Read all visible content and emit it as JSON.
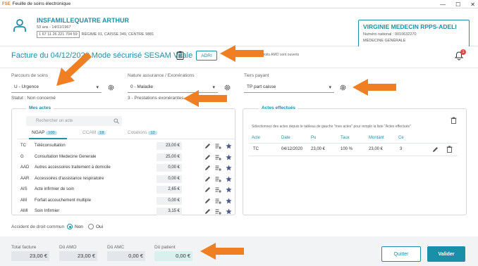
{
  "window": {
    "logo": "FSE",
    "title": "Feuille de soins électronique",
    "minimize_glyph": "—",
    "maximize_glyph": "☐",
    "close_glyph": "✕"
  },
  "patient": {
    "name": "INSFAMILLEQUATRE ARTHUR",
    "birth_info": "53 ans - 14/11/1967",
    "nir": "1 67 11 26 221 704 59",
    "regime": "RÉGIME 01, CAISSE 349, CENTRE 9881"
  },
  "doctor": {
    "name": "VIRGINIE MEDECIN RPPS-ADELI",
    "national_number": "Numéro national : 0010632270",
    "specialty": "MÉDECINE GÉNÉRALE"
  },
  "invoice": {
    "title": "Facture du 04/12/2020 Mode sécurisé SESAM Vitale",
    "adri_label": "ADRI",
    "amo_note": "Droits AMO sont ouverts",
    "notification_count": "1"
  },
  "fields": {
    "parcours_label": "Parcours de soins",
    "parcours_value": "U - Urgence",
    "statut_note": "Statut : Non concerné",
    "nature_label": "Nature assurance / Exonérations",
    "nature_value": "0 - Maladie",
    "exoneration_note": "3 - Prestations exonérantes",
    "tiers_label": "Tiers payant",
    "tiers_value": "TP part caisse"
  },
  "mes_actes": {
    "legend": "Mes actes",
    "search_placeholder": "Rechercher un acte",
    "tabs": [
      {
        "label": "NGAP",
        "count": "100"
      },
      {
        "label": "CCAM",
        "count": "18"
      },
      {
        "label": "Cotations",
        "count": "12"
      }
    ],
    "rows": [
      {
        "code": "TC",
        "label": "Téléconsultation",
        "price": "23,00 €"
      },
      {
        "code": "G",
        "label": "Consultation Medecine Generale",
        "price": "25,00 €"
      },
      {
        "code": "AAD",
        "label": "Autres accessoires traitement à domicile",
        "price": "0,00 €"
      },
      {
        "code": "AAR",
        "label": "Accessoires d'assistance respiratoire",
        "price": "0,00 €"
      },
      {
        "code": "AIS",
        "label": "Acte infirmier de soin",
        "price": "2,65 €"
      },
      {
        "code": "AM",
        "label": "Forfait accouchement multiple",
        "price": "0,00 €"
      },
      {
        "code": "AMI",
        "label": "Soin Infirmier",
        "price": "3,15 €"
      }
    ]
  },
  "actes_effectues": {
    "legend": "Actes effectués",
    "hint": "Sélectionnez des actes depuis le tableau de gauche \"mes actes\" pour remplir la liste \"Actes effectués\"",
    "headers": [
      "Acte",
      "Date",
      "Pu",
      "Taux",
      "Montant",
      "Ce"
    ],
    "row": {
      "acte": "TC",
      "date": "04/12/2020",
      "pu": "23,00 €",
      "taux": "100 %",
      "montant": "23,00 €",
      "ce": "3"
    }
  },
  "accident": {
    "label": "Accident de droit commun",
    "no": "Non",
    "yes": "Oui",
    "selected": "Non"
  },
  "totals": {
    "total_label": "Total facture",
    "total_value": "23,00 €",
    "amo_label": "Dû AMO",
    "amo_value": "23,00 €",
    "amc_label": "Dû AMC",
    "amc_value": "0,00 €",
    "patient_label": "Dû patient",
    "patient_value": "0,00 €"
  },
  "buttons": {
    "quit": "Quitter",
    "validate": "Valider"
  },
  "colors": {
    "accent": "#1a8fa8",
    "annotation_arrow": "#ef7f22",
    "alert": "#e04848"
  }
}
